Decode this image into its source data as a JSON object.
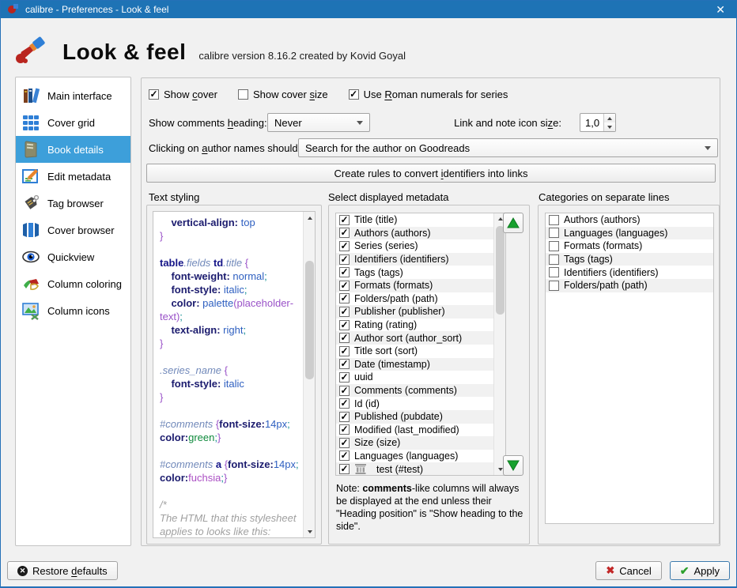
{
  "window": {
    "title": "calibre - Preferences - Look & feel",
    "close_label": "✕"
  },
  "header": {
    "title": "Look & feel",
    "subtitle": "calibre version 8.16.2 created by Kovid Goyal"
  },
  "colors": {
    "titlebar": "#1e73b5",
    "sidebar_selected": "#3d9fda",
    "arrow_green": "#17a12e",
    "cancel_red": "#c22727",
    "apply_green": "#2ca02c"
  },
  "sidebar": {
    "items": [
      {
        "label": "Main interface",
        "icon": "main-interface-icon",
        "selected": false
      },
      {
        "label": "Cover grid",
        "icon": "cover-grid-icon",
        "selected": false
      },
      {
        "label": "Book details",
        "icon": "book-details-icon",
        "selected": true
      },
      {
        "label": "Edit metadata",
        "icon": "edit-metadata-icon",
        "selected": false
      },
      {
        "label": "Tag browser",
        "icon": "tag-browser-icon",
        "selected": false
      },
      {
        "label": "Cover browser",
        "icon": "cover-browser-icon",
        "selected": false
      },
      {
        "label": "Quickview",
        "icon": "quickview-icon",
        "selected": false
      },
      {
        "label": "Column coloring",
        "icon": "column-coloring-icon",
        "selected": false
      },
      {
        "label": "Column icons",
        "icon": "column-icons-icon",
        "selected": false
      }
    ]
  },
  "options": {
    "show_cover": {
      "text": "Show cover",
      "u": 5,
      "checked": true
    },
    "show_cover_size": {
      "text": "Show cover size",
      "u": 11,
      "checked": false
    },
    "roman_numerals": {
      "text": "Use Roman numerals for series",
      "u": 4,
      "checked": true
    },
    "comments_heading_label": {
      "text": "Show comments heading:",
      "u": 14
    },
    "comments_heading_value": "Never",
    "icon_size_label": {
      "text": "Link and note icon size:",
      "u": 21
    },
    "icon_size_value": "1,0",
    "author_click_label": {
      "text": "Clicking on author names should:",
      "u": 12
    },
    "author_click_value": "Search for the author on Goodreads",
    "create_rules_button": {
      "text": "Create rules to convert identifiers into links",
      "u": 24
    }
  },
  "text_styling": {
    "title": "Text styling",
    "code_lines": [
      [
        [
          "p",
          "    vertical-align:"
        ],
        [
          "v",
          " top"
        ]
      ],
      [
        [
          "b",
          "}"
        ]
      ],
      [],
      [
        [
          "t",
          "table"
        ],
        [
          "c",
          ".fields"
        ],
        [
          "x",
          " "
        ],
        [
          "t",
          "td"
        ],
        [
          "c",
          ".title"
        ],
        [
          "x",
          " "
        ],
        [
          "b",
          "{"
        ]
      ],
      [
        [
          "p",
          "    font-weight:"
        ],
        [
          "v",
          " normal"
        ],
        [
          "s",
          ";"
        ]
      ],
      [
        [
          "p",
          "    font-style:"
        ],
        [
          "v",
          " italic"
        ],
        [
          "s",
          ";"
        ]
      ],
      [
        [
          "p",
          "    color:"
        ],
        [
          "v",
          " palette"
        ],
        [
          "b",
          "(placeholder-"
        ]
      ],
      [
        [
          "b",
          "text)"
        ],
        [
          "s",
          ";"
        ]
      ],
      [
        [
          "p",
          "    text-align:"
        ],
        [
          "v",
          " right"
        ],
        [
          "s",
          ";"
        ]
      ],
      [
        [
          "b",
          "}"
        ]
      ],
      [],
      [
        [
          "c",
          ".series_name"
        ],
        [
          "x",
          " "
        ],
        [
          "b",
          "{"
        ]
      ],
      [
        [
          "p",
          "    font-style:"
        ],
        [
          "v",
          " italic"
        ]
      ],
      [
        [
          "b",
          "}"
        ]
      ],
      [],
      [
        [
          "c",
          "#comments"
        ],
        [
          "x",
          " "
        ],
        [
          "b",
          "{"
        ],
        [
          "p",
          "font-size:"
        ],
        [
          "v",
          "14px"
        ],
        [
          "s",
          ";"
        ]
      ],
      [
        [
          "p",
          "color:"
        ],
        [
          "kg",
          "green"
        ],
        [
          "s",
          ";"
        ],
        [
          "b",
          "}"
        ]
      ],
      [],
      [
        [
          "c",
          "#comments"
        ],
        [
          "x",
          " "
        ],
        [
          "t",
          "a"
        ],
        [
          "x",
          " "
        ],
        [
          "b",
          "{"
        ],
        [
          "p",
          "font-size:"
        ],
        [
          "v",
          "14px"
        ],
        [
          "s",
          ";"
        ]
      ],
      [
        [
          "p",
          "color:"
        ],
        [
          "kf",
          "fuchsia"
        ],
        [
          "s",
          ";"
        ],
        [
          "b",
          "}"
        ]
      ],
      [],
      [
        [
          "g",
          "/*"
        ]
      ],
      [
        [
          "g",
          "The HTML that this stylesheet"
        ]
      ],
      [
        [
          "g",
          "applies to looks like this:"
        ]
      ]
    ]
  },
  "metadata": {
    "title": "Select displayed metadata",
    "items": [
      {
        "label": "Title (title)",
        "checked": true
      },
      {
        "label": "Authors (authors)",
        "checked": true
      },
      {
        "label": "Series (series)",
        "checked": true
      },
      {
        "label": "Identifiers (identifiers)",
        "checked": true
      },
      {
        "label": "Tags (tags)",
        "checked": true
      },
      {
        "label": "Formats (formats)",
        "checked": true
      },
      {
        "label": "Folders/path (path)",
        "checked": true
      },
      {
        "label": "Publisher (publisher)",
        "checked": true
      },
      {
        "label": "Rating (rating)",
        "checked": true
      },
      {
        "label": "Author sort (author_sort)",
        "checked": true
      },
      {
        "label": "Title sort (sort)",
        "checked": true
      },
      {
        "label": "Date (timestamp)",
        "checked": true
      },
      {
        "label": "uuid",
        "checked": true
      },
      {
        "label": "Comments (comments)",
        "checked": true
      },
      {
        "label": "Id (id)",
        "checked": true
      },
      {
        "label": "Published (pubdate)",
        "checked": true
      },
      {
        "label": "Modified (last_modified)",
        "checked": true
      },
      {
        "label": "Size (size)",
        "checked": true
      },
      {
        "label": "Languages (languages)",
        "checked": true
      },
      {
        "label": "test (#test)",
        "checked": true,
        "icon": "column-icon"
      }
    ],
    "note": {
      "prefix": "Note: ",
      "bold": "comments",
      "suffix": "-like columns will always be displayed at the end unless their \"Heading position\" is \"Show heading to the side\"."
    }
  },
  "categories": {
    "title": "Categories on separate lines",
    "items": [
      {
        "label": "Authors (authors)",
        "checked": false
      },
      {
        "label": "Languages (languages)",
        "checked": false
      },
      {
        "label": "Formats (formats)",
        "checked": false
      },
      {
        "label": "Tags (tags)",
        "checked": false
      },
      {
        "label": "Identifiers (identifiers)",
        "checked": false
      },
      {
        "label": "Folders/path (path)",
        "checked": false
      }
    ]
  },
  "footer": {
    "restore_defaults": {
      "text": "Restore defaults",
      "u": 8
    },
    "cancel": "Cancel",
    "apply": "Apply"
  }
}
